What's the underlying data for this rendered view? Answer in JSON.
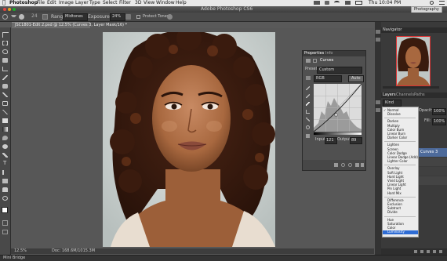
{
  "menubar": {
    "app_name": "Photoshop",
    "menus": [
      "File",
      "Edit",
      "Image",
      "Layer",
      "Type",
      "Select",
      "Filter",
      "3D",
      "View",
      "Window",
      "Help"
    ],
    "clock": "Thu 10:04 PM"
  },
  "window": {
    "title": "Adobe Photoshop CS6",
    "workspace": "Photography"
  },
  "options_bar": {
    "range_label": "Range:",
    "range_value": "Midtones",
    "exposure_label": "Exposure:",
    "exposure_value": "24%",
    "protect_tones": "Protect Tones"
  },
  "document": {
    "tab_title": "JSC1801-Edit 2.psd @ 12.5% (Curves 3, Layer Mask/16) *",
    "zoom": "12.5%",
    "doc_info": "Doc: 168.6M/1015.3M"
  },
  "mini_bridge": {
    "label": "Mini Bridge"
  },
  "properties_panel": {
    "tabs": [
      "Properties",
      "Info"
    ],
    "title": "Curves",
    "preset_label": "Preset:",
    "preset_value": "Custom",
    "channel_value": "RGB",
    "auto_label": "Auto",
    "input_label": "Input:",
    "input_value": "121",
    "output_label": "Output:",
    "output_value": "89"
  },
  "navigator": {
    "title": "Navigator"
  },
  "layers_panel": {
    "tabs": [
      "Layers",
      "Channels",
      "Paths"
    ],
    "kind_label": "Kind",
    "opacity_label": "Opacity:",
    "opacity_value": "100%",
    "fill_label": "Fill:",
    "fill_value": "100%",
    "layer_name": "Curves 3"
  },
  "blend_modes": {
    "groups": [
      [
        "Normal",
        "Dissolve"
      ],
      [
        "Darken",
        "Multiply",
        "Color Burn",
        "Linear Burn",
        "Darker Color"
      ],
      [
        "Lighten",
        "Screen",
        "Color Dodge",
        "Linear Dodge (Add)",
        "Lighter Color"
      ],
      [
        "Overlay",
        "Soft Light",
        "Hard Light",
        "Vivid Light",
        "Linear Light",
        "Pin Light",
        "Hard Mix"
      ],
      [
        "Difference",
        "Exclusion",
        "Subtract",
        "Divide"
      ],
      [
        "Hue",
        "Saturation",
        "Color",
        "Luminosity"
      ]
    ],
    "checked": "Normal",
    "highlighted": "Luminosity"
  },
  "colors": {
    "highlight": "#2e6cd4",
    "panel_dark": "#3a3a3a",
    "panel_mid": "#505050"
  },
  "icons": [
    "apple-icon",
    "move-tool-icon",
    "marquee-tool-icon",
    "lasso-tool-icon",
    "quick-select-tool-icon",
    "crop-tool-icon",
    "eyedropper-tool-icon",
    "healing-brush-icon",
    "brush-tool-icon",
    "clone-stamp-icon",
    "history-brush-icon",
    "eraser-tool-icon",
    "gradient-tool-icon",
    "blur-tool-icon",
    "dodge-tool-icon",
    "pen-tool-icon",
    "type-tool-icon",
    "path-select-icon",
    "shape-tool-icon",
    "hand-tool-icon",
    "zoom-tool-icon"
  ]
}
